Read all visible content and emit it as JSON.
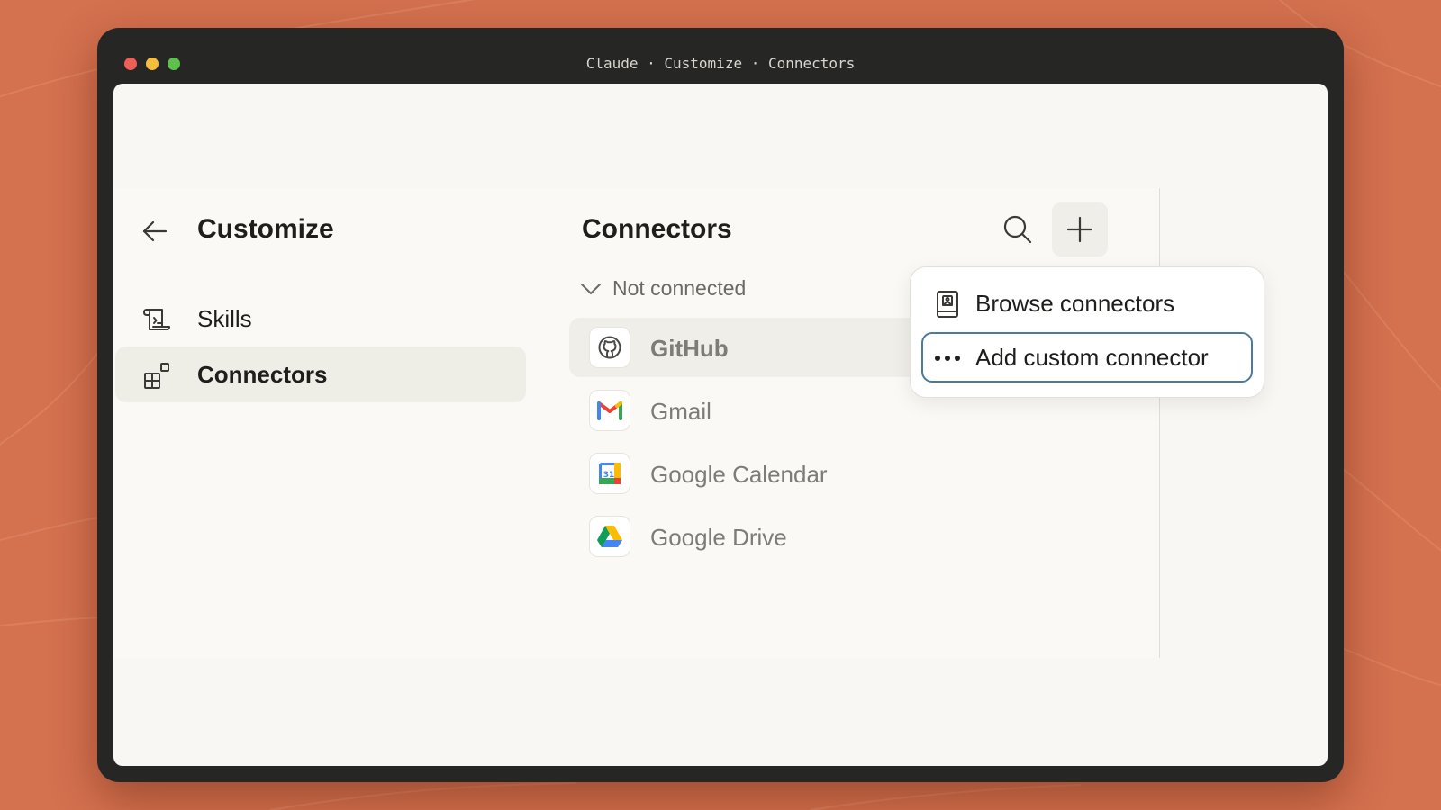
{
  "window": {
    "title": "Claude · Customize · Connectors"
  },
  "sidebar": {
    "back_icon": "arrow-left-icon",
    "title": "Customize",
    "items": [
      {
        "label": "Skills",
        "icon": "scroll-icon",
        "active": false
      },
      {
        "label": "Connectors",
        "icon": "connectors-icon",
        "active": true
      }
    ]
  },
  "main": {
    "title": "Connectors",
    "search_icon": "search-icon",
    "add_icon": "plus-icon",
    "section": {
      "label": "Not connected",
      "icon": "chevron-down-icon",
      "expanded": true
    },
    "connectors": [
      {
        "name": "GitHub",
        "icon": "github-icon",
        "hovered": true
      },
      {
        "name": "Gmail",
        "icon": "gmail-icon",
        "hovered": false
      },
      {
        "name": "Google Calendar",
        "icon": "google-calendar-icon",
        "calendar_day": "31",
        "hovered": false
      },
      {
        "name": "Google Drive",
        "icon": "google-drive-icon",
        "hovered": false
      }
    ]
  },
  "menu": {
    "items": [
      {
        "label": "Browse connectors",
        "icon": "book-icon",
        "focused": false
      },
      {
        "label": "Add custom connector",
        "icon": "more-dots-icon",
        "focused": true
      }
    ]
  },
  "colors": {
    "background": "#d4714f",
    "window_frame": "#262624",
    "content": "#faf9f5",
    "focus_ring": "#4a7aa0",
    "text_primary": "#1f1e1c",
    "text_muted": "#7e7c76"
  }
}
